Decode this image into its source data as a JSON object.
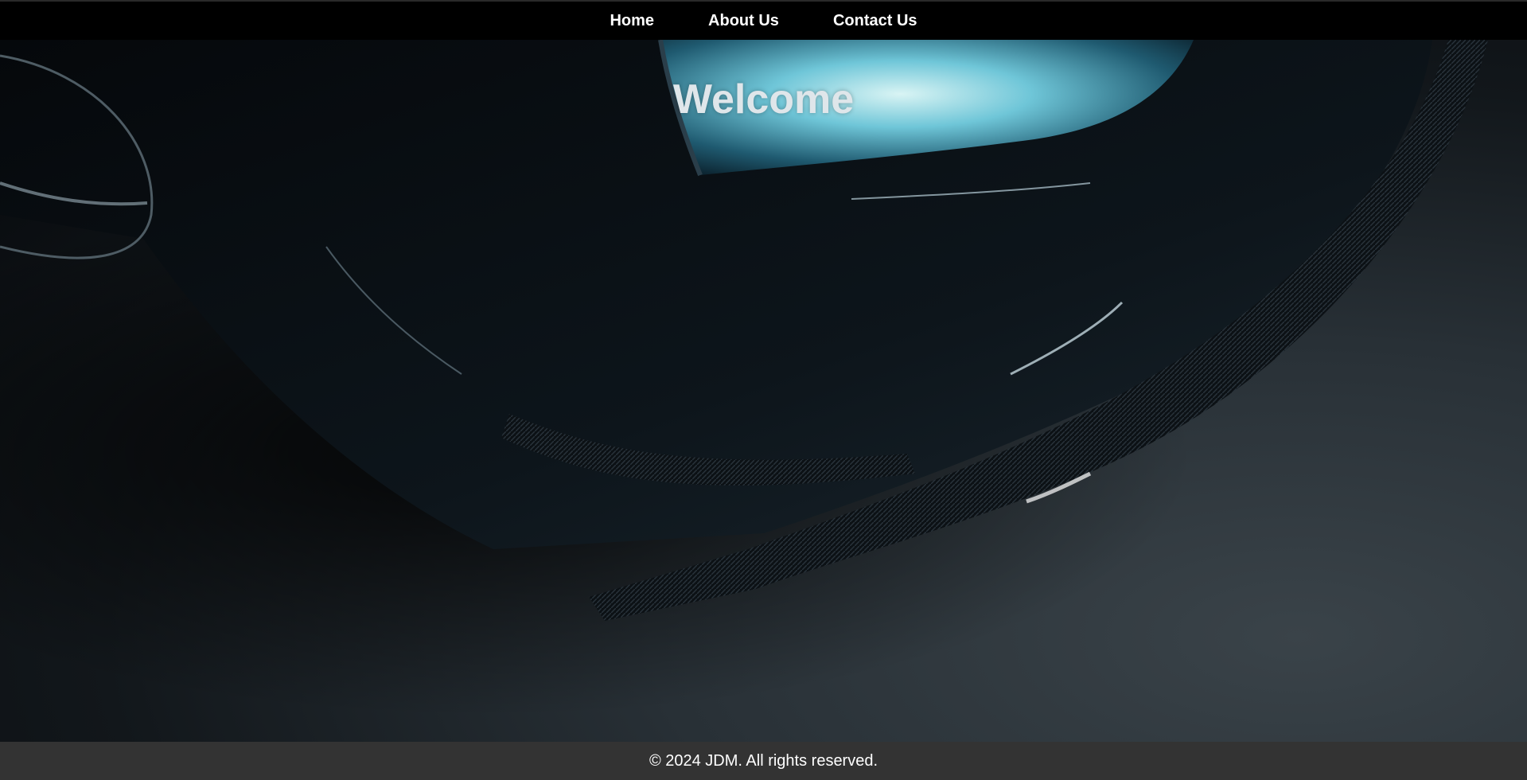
{
  "nav": {
    "items": [
      {
        "label": "Home"
      },
      {
        "label": "About Us"
      },
      {
        "label": "Contact Us"
      }
    ]
  },
  "hero": {
    "title": "Welcome",
    "background": "dark car front bumper with carbon lip and headlight on asphalt"
  },
  "footer": {
    "text": "© 2024 JDM. All rights reserved."
  },
  "colors": {
    "navbar_bg": "#000000",
    "footer_bg": "#333333",
    "text": "#ffffff",
    "headlight": "#6fd3e6"
  }
}
